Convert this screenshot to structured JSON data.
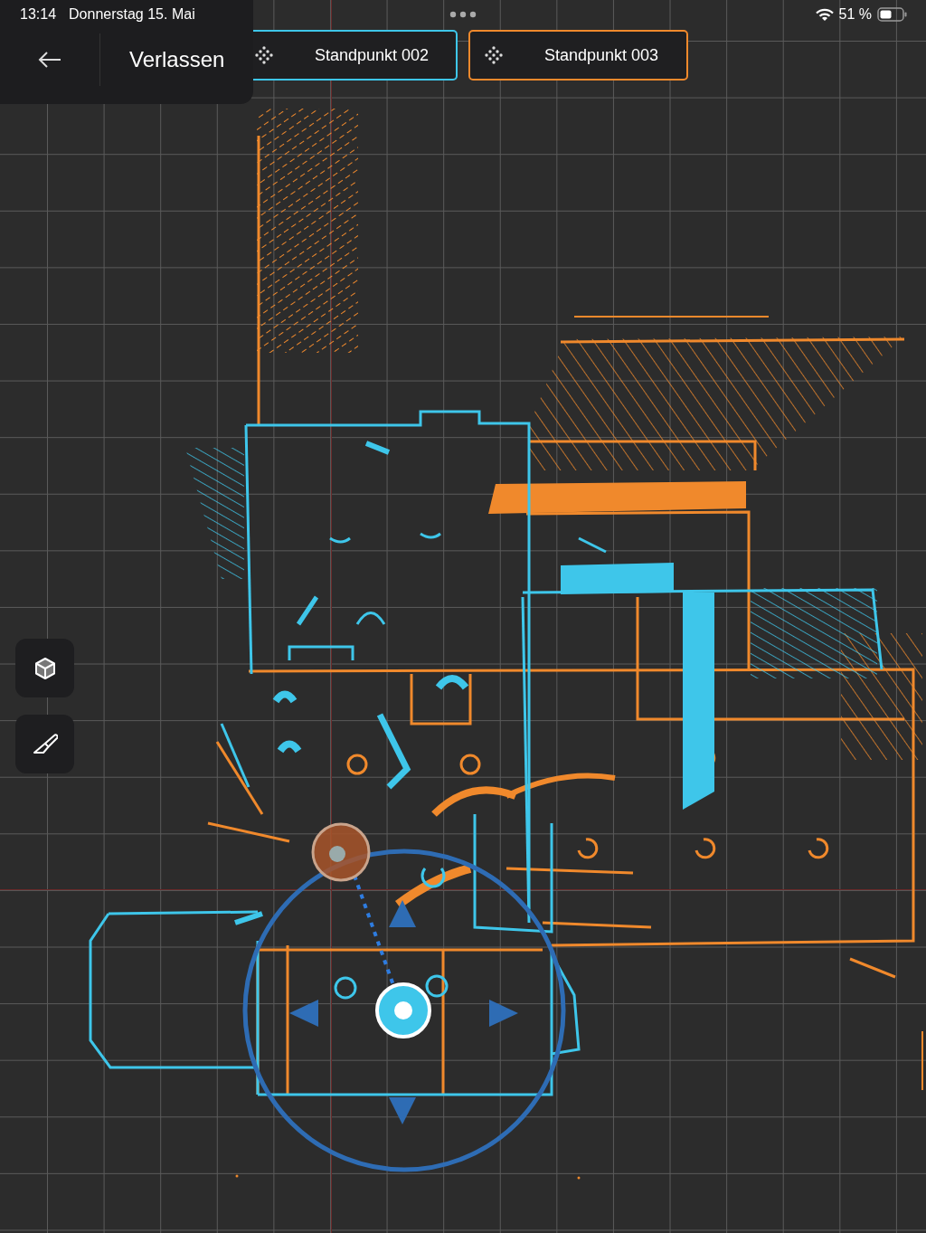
{
  "status_bar": {
    "time": "13:14",
    "date": "Donnerstag 15. Mai",
    "battery": "51 %"
  },
  "toolbar": {
    "exit_label": "Verlassen"
  },
  "stations": [
    {
      "label": "Standpunkt 002",
      "color": "#3ec6ea"
    },
    {
      "label": "Standpunkt 003",
      "color": "#f0892c"
    }
  ]
}
